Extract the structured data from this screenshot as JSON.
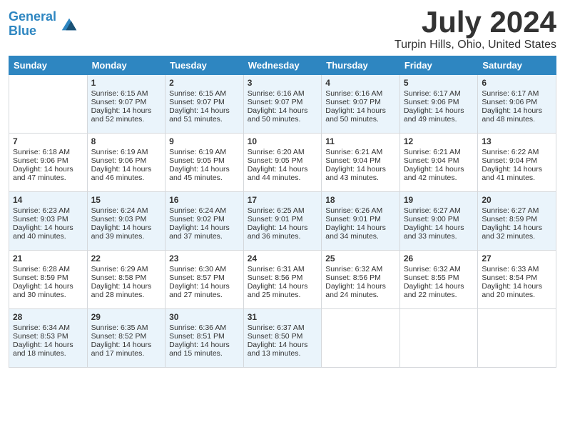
{
  "logo": {
    "line1": "General",
    "line2": "Blue"
  },
  "title": "July 2024",
  "location": "Turpin Hills, Ohio, United States",
  "days_header": [
    "Sunday",
    "Monday",
    "Tuesday",
    "Wednesday",
    "Thursday",
    "Friday",
    "Saturday"
  ],
  "weeks": [
    [
      {
        "day": "",
        "info": ""
      },
      {
        "day": "1",
        "info": "Sunrise: 6:15 AM\nSunset: 9:07 PM\nDaylight: 14 hours\nand 52 minutes."
      },
      {
        "day": "2",
        "info": "Sunrise: 6:15 AM\nSunset: 9:07 PM\nDaylight: 14 hours\nand 51 minutes."
      },
      {
        "day": "3",
        "info": "Sunrise: 6:16 AM\nSunset: 9:07 PM\nDaylight: 14 hours\nand 50 minutes."
      },
      {
        "day": "4",
        "info": "Sunrise: 6:16 AM\nSunset: 9:07 PM\nDaylight: 14 hours\nand 50 minutes."
      },
      {
        "day": "5",
        "info": "Sunrise: 6:17 AM\nSunset: 9:06 PM\nDaylight: 14 hours\nand 49 minutes."
      },
      {
        "day": "6",
        "info": "Sunrise: 6:17 AM\nSunset: 9:06 PM\nDaylight: 14 hours\nand 48 minutes."
      }
    ],
    [
      {
        "day": "7",
        "info": "Sunrise: 6:18 AM\nSunset: 9:06 PM\nDaylight: 14 hours\nand 47 minutes."
      },
      {
        "day": "8",
        "info": "Sunrise: 6:19 AM\nSunset: 9:06 PM\nDaylight: 14 hours\nand 46 minutes."
      },
      {
        "day": "9",
        "info": "Sunrise: 6:19 AM\nSunset: 9:05 PM\nDaylight: 14 hours\nand 45 minutes."
      },
      {
        "day": "10",
        "info": "Sunrise: 6:20 AM\nSunset: 9:05 PM\nDaylight: 14 hours\nand 44 minutes."
      },
      {
        "day": "11",
        "info": "Sunrise: 6:21 AM\nSunset: 9:04 PM\nDaylight: 14 hours\nand 43 minutes."
      },
      {
        "day": "12",
        "info": "Sunrise: 6:21 AM\nSunset: 9:04 PM\nDaylight: 14 hours\nand 42 minutes."
      },
      {
        "day": "13",
        "info": "Sunrise: 6:22 AM\nSunset: 9:04 PM\nDaylight: 14 hours\nand 41 minutes."
      }
    ],
    [
      {
        "day": "14",
        "info": "Sunrise: 6:23 AM\nSunset: 9:03 PM\nDaylight: 14 hours\nand 40 minutes."
      },
      {
        "day": "15",
        "info": "Sunrise: 6:24 AM\nSunset: 9:03 PM\nDaylight: 14 hours\nand 39 minutes."
      },
      {
        "day": "16",
        "info": "Sunrise: 6:24 AM\nSunset: 9:02 PM\nDaylight: 14 hours\nand 37 minutes."
      },
      {
        "day": "17",
        "info": "Sunrise: 6:25 AM\nSunset: 9:01 PM\nDaylight: 14 hours\nand 36 minutes."
      },
      {
        "day": "18",
        "info": "Sunrise: 6:26 AM\nSunset: 9:01 PM\nDaylight: 14 hours\nand 34 minutes."
      },
      {
        "day": "19",
        "info": "Sunrise: 6:27 AM\nSunset: 9:00 PM\nDaylight: 14 hours\nand 33 minutes."
      },
      {
        "day": "20",
        "info": "Sunrise: 6:27 AM\nSunset: 8:59 PM\nDaylight: 14 hours\nand 32 minutes."
      }
    ],
    [
      {
        "day": "21",
        "info": "Sunrise: 6:28 AM\nSunset: 8:59 PM\nDaylight: 14 hours\nand 30 minutes."
      },
      {
        "day": "22",
        "info": "Sunrise: 6:29 AM\nSunset: 8:58 PM\nDaylight: 14 hours\nand 28 minutes."
      },
      {
        "day": "23",
        "info": "Sunrise: 6:30 AM\nSunset: 8:57 PM\nDaylight: 14 hours\nand 27 minutes."
      },
      {
        "day": "24",
        "info": "Sunrise: 6:31 AM\nSunset: 8:56 PM\nDaylight: 14 hours\nand 25 minutes."
      },
      {
        "day": "25",
        "info": "Sunrise: 6:32 AM\nSunset: 8:56 PM\nDaylight: 14 hours\nand 24 minutes."
      },
      {
        "day": "26",
        "info": "Sunrise: 6:32 AM\nSunset: 8:55 PM\nDaylight: 14 hours\nand 22 minutes."
      },
      {
        "day": "27",
        "info": "Sunrise: 6:33 AM\nSunset: 8:54 PM\nDaylight: 14 hours\nand 20 minutes."
      }
    ],
    [
      {
        "day": "28",
        "info": "Sunrise: 6:34 AM\nSunset: 8:53 PM\nDaylight: 14 hours\nand 18 minutes."
      },
      {
        "day": "29",
        "info": "Sunrise: 6:35 AM\nSunset: 8:52 PM\nDaylight: 14 hours\nand 17 minutes."
      },
      {
        "day": "30",
        "info": "Sunrise: 6:36 AM\nSunset: 8:51 PM\nDaylight: 14 hours\nand 15 minutes."
      },
      {
        "day": "31",
        "info": "Sunrise: 6:37 AM\nSunset: 8:50 PM\nDaylight: 14 hours\nand 13 minutes."
      },
      {
        "day": "",
        "info": ""
      },
      {
        "day": "",
        "info": ""
      },
      {
        "day": "",
        "info": ""
      }
    ]
  ]
}
